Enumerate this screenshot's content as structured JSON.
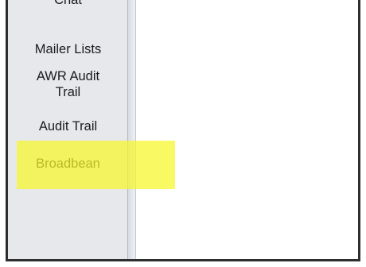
{
  "sidebar": {
    "items": [
      {
        "label": "Chat"
      },
      {
        "label": "Mailer Lists"
      },
      {
        "label": "AWR Audit Trail"
      },
      {
        "label": "Audit Trail"
      },
      {
        "label": "Broadbean",
        "highlighted": true
      }
    ]
  },
  "colors": {
    "sidebar_bg": "#e6e8ec",
    "highlight": "#f6f628",
    "frame_border": "#2e2e2e",
    "content_bg": "#ffffff"
  }
}
